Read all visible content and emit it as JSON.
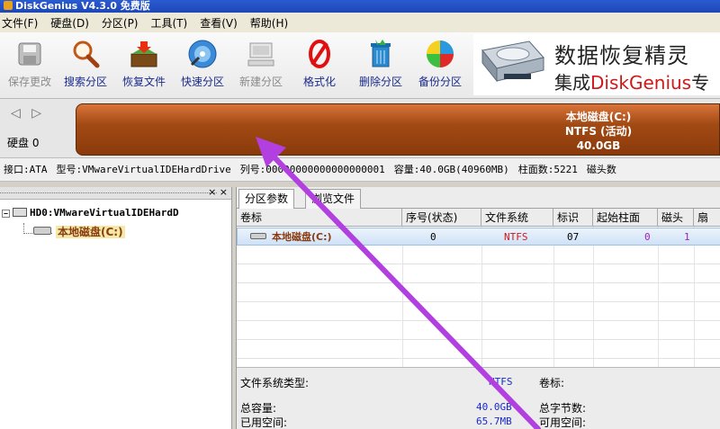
{
  "window": {
    "title": "DiskGenius V4.3.0 免费版"
  },
  "menu": [
    "文件(F)",
    "硬盘(D)",
    "分区(P)",
    "工具(T)",
    "查看(V)",
    "帮助(H)"
  ],
  "toolbar": {
    "buttons": [
      {
        "label": "保存更改",
        "icon": "save-icon",
        "enabled": false
      },
      {
        "label": "搜索分区",
        "icon": "magnifier-icon",
        "enabled": true
      },
      {
        "label": "恢复文件",
        "icon": "recover-box-icon",
        "enabled": true
      },
      {
        "label": "快速分区",
        "icon": "quick-partition-disc-icon",
        "enabled": true
      },
      {
        "label": "新建分区",
        "icon": "new-partition-computer-icon",
        "enabled": false
      },
      {
        "label": "格式化",
        "icon": "format-forbidden-icon",
        "enabled": true
      },
      {
        "label": "删除分区",
        "icon": "trash-bin-icon",
        "enabled": true
      },
      {
        "label": "备份分区",
        "icon": "backup-pie-icon",
        "enabled": true
      }
    ],
    "banner": {
      "line1": "数据恢复精灵",
      "line2_prefix": "集成",
      "line2_brand": "DiskGenius",
      "line2_suffix": "专"
    }
  },
  "disk_band": {
    "nav_arrows": "◁ ▷",
    "disk_label": "硬盘 0",
    "partition": {
      "name": "本地磁盘(C:)",
      "fs": "NTFS (活动)",
      "size": "40.0GB"
    }
  },
  "disk_info": {
    "interface": "接口:ATA",
    "model": "型号:VMwareVirtualIDEHardDrive",
    "serial": "列号:00000000000000000001",
    "capacity": "容量:40.0GB(40960MB)",
    "cylinders": "柱面数:5221",
    "heads": "磁头数"
  },
  "tree": {
    "disk_node": "HD0:VMwareVirtualIDEHardD",
    "partition_node": "本地磁盘(C:)"
  },
  "tabs": [
    "分区参数",
    "浏览文件"
  ],
  "grid": {
    "headers": [
      "卷标",
      "序号(状态)",
      "文件系统",
      "标识",
      "起始柱面",
      "磁头",
      "扇"
    ],
    "rows": [
      {
        "label": "本地磁盘(C:)",
        "index": "0",
        "fs": "NTFS",
        "id": "07",
        "start_cyl": "0",
        "head": "1"
      }
    ]
  },
  "details": {
    "fs_type_label": "文件系统类型:",
    "fs_type_value": "NTFS",
    "volume_label": "卷标:",
    "total_label": "总容量:",
    "total_value": "40.0GB",
    "used_label": "已用空间:",
    "used_value": "65.7MB",
    "total_bytes_label": "总字节数:",
    "free_label": "可用空间:"
  },
  "colors": {
    "partition_bar": "#a24a14",
    "selected_row": "#cfe2f7",
    "annotation_arrow": "#b23fe0",
    "fs_text_red": "#d01818",
    "value_blue": "#1a2acc"
  }
}
